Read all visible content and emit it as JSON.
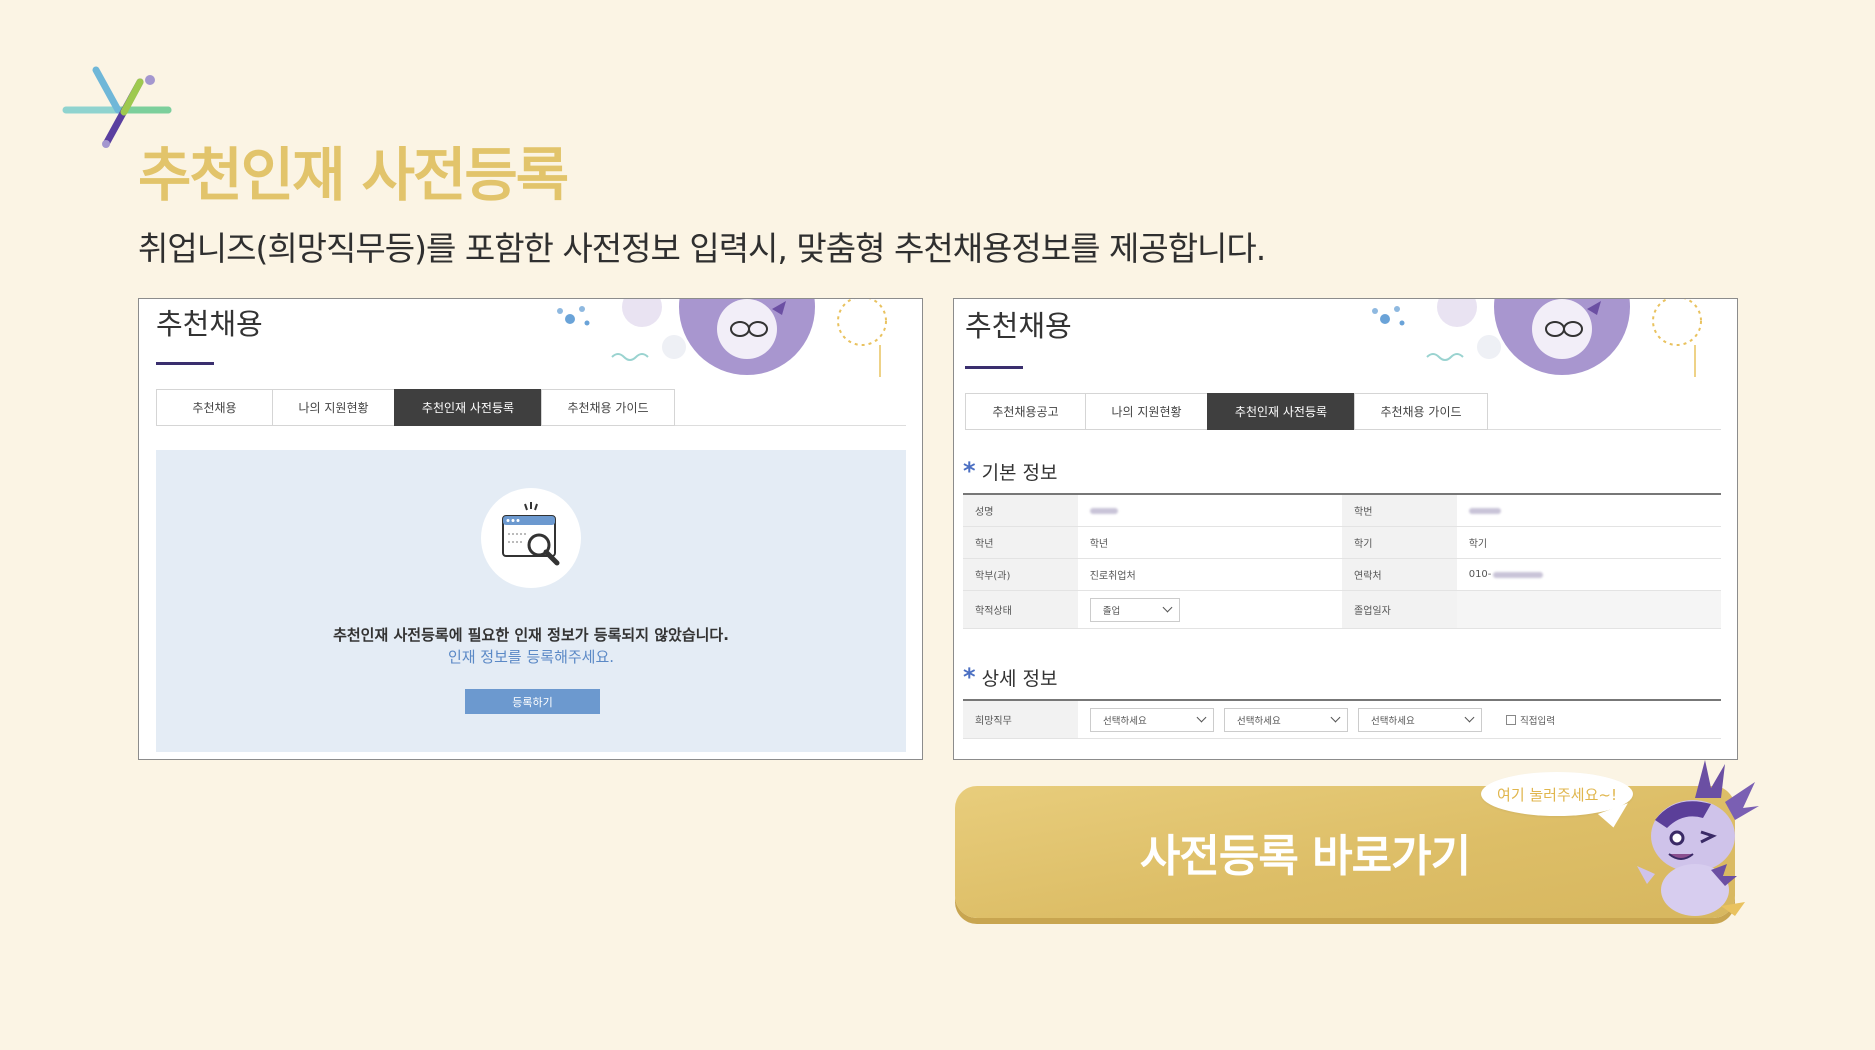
{
  "page": {
    "title": "추천인재 사전등록",
    "subtitle": "취업니즈(희망직무등)를 포함한 사전정보 입력시, 맞춤형 추천채용정보를 제공합니다."
  },
  "left_panel": {
    "title": "추천채용",
    "tabs": [
      "추천채용",
      "나의 지원현황",
      "추천인재 사전등록",
      "추천채용 가이드"
    ],
    "active_tab": "추천인재 사전등록",
    "empty_message": "추천인재 사전등록에 필요한 인재 정보가 등록되지 않았습니다.",
    "empty_submessage": "인재 정보를 등록해주세요.",
    "register_button": "등록하기",
    "empty_icon": "browser-search-icon"
  },
  "right_panel": {
    "title": "추천채용",
    "tabs": [
      "추천채용공고",
      "나의 지원현황",
      "추천인재 사전등록",
      "추천채용 가이드"
    ],
    "active_tab": "추천인재 사전등록",
    "basic_section": "기본 정보",
    "basic_rows": [
      {
        "label1": "성명",
        "value1": "",
        "label2": "학번",
        "value2": ""
      },
      {
        "label1": "학년",
        "value1": "학년",
        "label2": "학기",
        "value2": "학기"
      },
      {
        "label1": "학부(과)",
        "value1": "진로취업처",
        "label2": "연락처",
        "value2": "010-"
      },
      {
        "label1": "학적상태",
        "value1": "졸업",
        "label2": "졸업일자",
        "value2": ""
      }
    ],
    "detail_section": "상세 정보",
    "detail_row": {
      "label": "희망직무",
      "selects": [
        "선택하세요",
        "선택하세요",
        "선택하세요"
      ],
      "checkbox_label": "직접입력"
    }
  },
  "cta": {
    "label": "사전등록 바로가기",
    "speech_bubble": "여기 눌러주세요~!"
  },
  "colors": {
    "background": "#FBF4E4",
    "title": "#E2C46B",
    "cta": "#DDBE67",
    "active_tab": "#3f3f3f",
    "accent_blue": "#6c99cf",
    "mascot_purple": "#6B4FA3"
  }
}
